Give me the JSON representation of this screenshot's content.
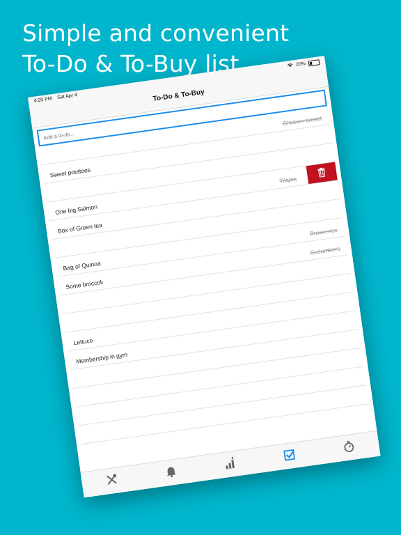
{
  "headline": {
    "line1": "Simple and convenient",
    "line2": "To-Do & To-Buy list"
  },
  "status": {
    "time": "4:20 PM",
    "date": "Sat Apr 4",
    "battery": "20%"
  },
  "nav": {
    "title": "To-Do & To-Buy"
  },
  "input": {
    "placeholder": "Add a to-do..."
  },
  "rows": [
    {
      "left": "",
      "right": "Chicken breast"
    },
    {
      "left": "Sweet potatoes",
      "right": ""
    },
    {
      "left": "",
      "right": ""
    },
    {
      "left": "One big Salmon",
      "right": "Tilapia"
    },
    {
      "left": "Box of Green tea",
      "right": ""
    },
    {
      "left": "",
      "right": ""
    },
    {
      "left": "Bag of Quinoa",
      "right": "Brown rice"
    },
    {
      "left": "Some broccoli",
      "right": "Cucumbers"
    },
    {
      "left": "",
      "right": ""
    },
    {
      "left": "",
      "right": ""
    },
    {
      "left": "Lettuce",
      "right": ""
    },
    {
      "left": "Membership in gym",
      "right": ""
    },
    {
      "left": "",
      "right": ""
    },
    {
      "left": "",
      "right": ""
    },
    {
      "left": "",
      "right": ""
    },
    {
      "left": "",
      "right": ""
    }
  ],
  "tabs": [
    {
      "icon": "utensils-icon"
    },
    {
      "icon": "bell-icon"
    },
    {
      "icon": "chart-bars-icon"
    },
    {
      "icon": "checkbox-icon"
    },
    {
      "icon": "stopwatch-icon"
    }
  ],
  "colors": {
    "background": "#00b5cc",
    "accent": "#1f8dea",
    "delete": "#c1121f"
  }
}
